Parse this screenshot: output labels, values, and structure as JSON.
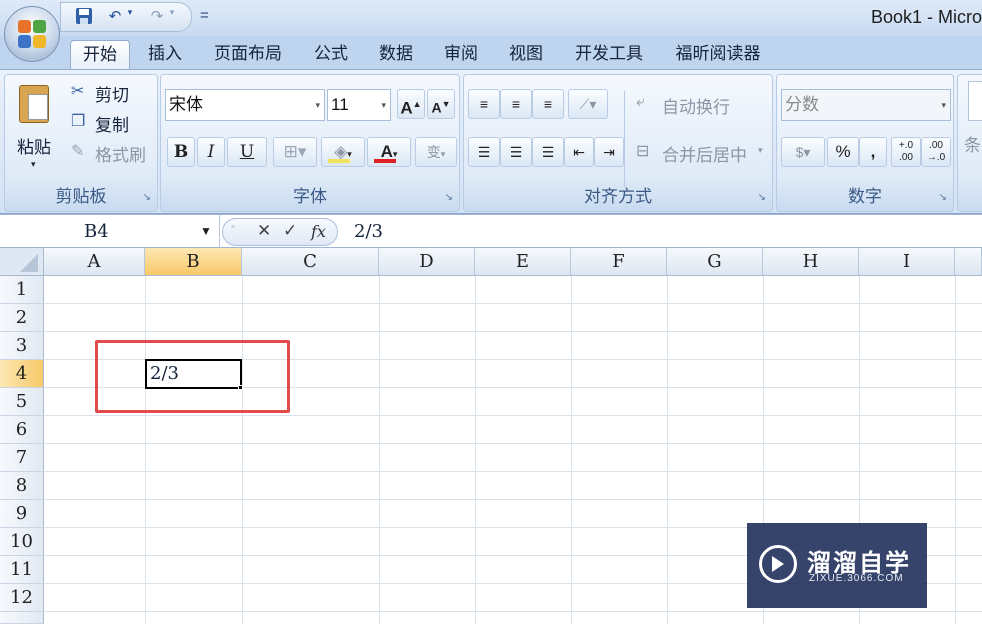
{
  "window": {
    "title": "Book1 - Micro"
  },
  "qat": {
    "save_icon": "save-icon",
    "undo": "↶",
    "redo": "↷",
    "customize": "="
  },
  "tabs": [
    "开始",
    "插入",
    "页面布局",
    "公式",
    "数据",
    "审阅",
    "视图",
    "开发工具",
    "福昕阅读器"
  ],
  "ribbon": {
    "clipboard": {
      "label": "剪贴板",
      "paste": "粘贴",
      "cut": "剪切",
      "copy": "复制",
      "format_painter": "格式刷"
    },
    "font": {
      "label": "字体",
      "font_name": "宋体",
      "font_size": "11",
      "bold": "B",
      "italic": "I",
      "underline": "U",
      "font_color_glyph": "A",
      "grow": "A",
      "shrink": "A",
      "phonetic": "wén",
      "phonetic_char": "变"
    },
    "alignment": {
      "label": "对齐方式",
      "wrap_text": "自动换行",
      "merge_center": "合并后居中"
    },
    "number": {
      "label": "数字",
      "format": "分数",
      "percent": "%",
      "comma": ",",
      "inc_decimal": "+.0 .00",
      "dec_decimal": ".00 →.0"
    },
    "styles": {
      "partial_label": "条"
    }
  },
  "formula_bar": {
    "name_box": "B4",
    "content": "2/3",
    "fx": "fx",
    "cancel": "✕",
    "enter": "✓"
  },
  "grid": {
    "columns": [
      "A",
      "B",
      "C",
      "D",
      "E",
      "F",
      "G",
      "H",
      "I"
    ],
    "rows": [
      "1",
      "2",
      "3",
      "4",
      "5",
      "6",
      "7",
      "8",
      "9",
      "10",
      "11",
      "12"
    ],
    "selected_column": "B",
    "selected_row": "4",
    "active_cell_value": "2/3"
  },
  "colors": {
    "highlight": "#e24b4b",
    "selected_header": "#f7c868"
  },
  "watermark": {
    "title": "溜溜自学",
    "subtitle": "ZIXUE.3066.COM"
  }
}
